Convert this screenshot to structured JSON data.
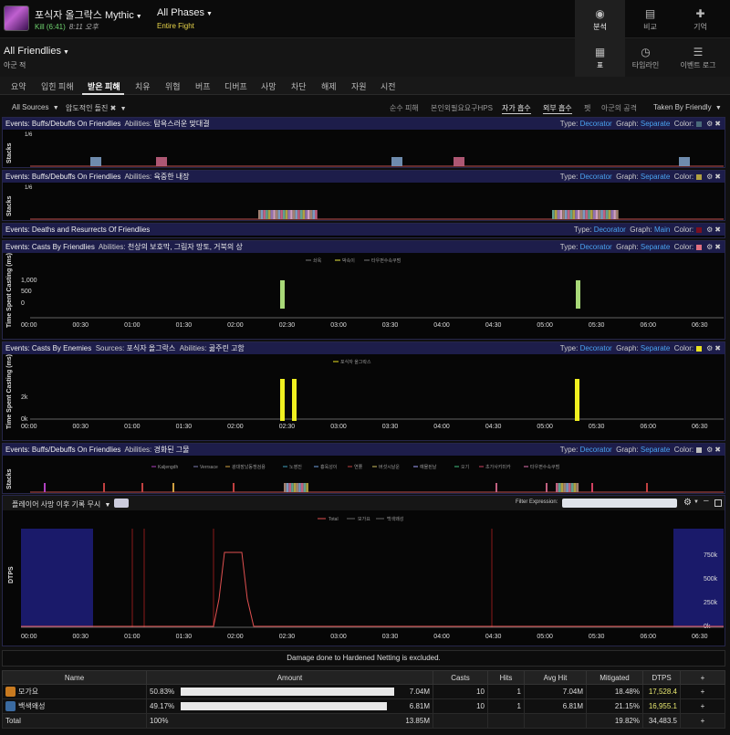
{
  "header": {
    "boss": "포식자 올그락스 Mythic",
    "kill": "Kill (6:41)",
    "time": "8:11 오후",
    "phase": "All Phases",
    "fight": "Entire Fight"
  },
  "nav": [
    {
      "label": "분석",
      "icon": "eye-icon"
    },
    {
      "label": "비교",
      "icon": "compare-icon"
    },
    {
      "label": "기억",
      "icon": "puzzle-icon"
    }
  ],
  "nav2": [
    {
      "label": "표",
      "icon": "grid-icon"
    },
    {
      "label": "타임라인",
      "icon": "clock-icon"
    },
    {
      "label": "이벤트 로그",
      "icon": "list-icon"
    }
  ],
  "scope": {
    "title": "All Friendlies",
    "sub": "아군 적"
  },
  "tabs": [
    "요약",
    "입힌 피해",
    "받은 피해",
    "치유",
    "위협",
    "버프",
    "디버프",
    "사망",
    "차단",
    "해제",
    "자원",
    "시전"
  ],
  "filters": {
    "sources": "All Sources",
    "ability": "압도적인 돌진",
    "options": [
      "순수 피해",
      "본인외필요요구HPS",
      "자가 흡수",
      "외부 흡수",
      "펫",
      "아군의 공격"
    ],
    "taken": "Taken By Friendly"
  },
  "panels": [
    {
      "head": "Events: Buffs/Debuffs On Friendlies",
      "abilLabel": "Abilities:",
      "abil": "탐욕스러운 맞대결",
      "type": "Decorator",
      "graph": "Separate",
      "color": "#4a6a7a",
      "ylabel": "Stacks",
      "stackLabel": "1/6"
    },
    {
      "head": "Events: Buffs/Debuffs On Friendlies",
      "abilLabel": "Abilities:",
      "abil": "육중한 내장",
      "type": "Decorator",
      "graph": "Separate",
      "color": "#b0a040",
      "ylabel": "Stacks",
      "stackLabel": "1/6"
    },
    {
      "head": "Events: Deaths and Resurrects Of Friendlies",
      "abilLabel": "",
      "abil": "",
      "type": "Decorator",
      "graph": "Main",
      "color": "#7a1020"
    },
    {
      "head": "Events: Casts By Friendlies",
      "abilLabel": "Abilities:",
      "abil": "천상의 보호막, 그림자 망토, 거북의 상",
      "type": "Decorator",
      "graph": "Separate",
      "color": "#e07080",
      "ylabel": "Time Spent Casting (ms)"
    },
    {
      "head": "Events: Casts By Enemies",
      "srcLabel": "Sources:",
      "src": "포식자 올그락스",
      "abilLabel": "Abilities:",
      "abil": "곪주린 고함",
      "type": "Decorator",
      "graph": "Separate",
      "color": "#e8e020",
      "ylabel": "Time Spent Casting (ms)"
    },
    {
      "head": "Events: Buffs/Debuffs On Friendlies",
      "abilLabel": "Abilities:",
      "abil": "경화된 그물",
      "type": "Decorator",
      "graph": "Separate",
      "color": "#bbbbbb",
      "ylabel": "Stacks"
    }
  ],
  "labels": {
    "type": "Type:",
    "graph": "Graph:",
    "color": "Color:"
  },
  "friendCasts": {
    "legend": [
      "솨옥",
      "박속이",
      "타우펀수속쿠범"
    ],
    "yticks": [
      "1,000",
      "500",
      "0"
    ]
  },
  "enemyCasts": {
    "legend": [
      "포식자 올그락스"
    ],
    "yticks": [
      "2k",
      "0k"
    ]
  },
  "debuffLegend": [
    "Kaljengdh",
    "Verrsace",
    "광대장났동쟁검용",
    "노영진",
    "흉욱성이",
    "연쭐",
    "버섯시날운",
    "예물된날",
    "오기",
    "초가사키미카",
    "타우편수속쿠범"
  ],
  "dtps": {
    "filter": "플레이어 사망 이후 기록 무시",
    "filterExprLabel": "Filter Expression:",
    "legend": [
      "Total",
      "모가요",
      "백색왜성"
    ],
    "ylabel": "DTPS",
    "yticks": [
      "750k",
      "500k",
      "250k",
      "0k"
    ]
  },
  "xticks": [
    "00:00",
    "00:30",
    "01:00",
    "01:30",
    "02:00",
    "02:30",
    "03:00",
    "03:30",
    "04:00",
    "04:30",
    "05:00",
    "05:30",
    "06:00",
    "06:30"
  ],
  "notice": "Damage done to Hardened Netting is excluded.",
  "table": {
    "headers": [
      "Name",
      "Amount",
      "Casts",
      "Hits",
      "Avg Hit",
      "Mitigated",
      "DTPS",
      "+"
    ],
    "rows": [
      {
        "name": "모가요",
        "pct": "50.83%",
        "frac": 0.5083,
        "amount": "7.04M",
        "casts": "10",
        "hits": "1",
        "avg": "7.04M",
        "mit": "18.48%",
        "dtps": "17,528.4",
        "plus": "+",
        "icon": "#c87a20"
      },
      {
        "name": "백색왜성",
        "pct": "49.17%",
        "frac": 0.4917,
        "amount": "6.81M",
        "casts": "10",
        "hits": "1",
        "avg": "6.81M",
        "mit": "21.15%",
        "dtps": "16,955.1",
        "plus": "+",
        "icon": "#3a6aa0"
      }
    ],
    "total": {
      "name": "Total",
      "pct": "100%",
      "amount": "13.85M",
      "mit": "19.82%",
      "dtps": "34,483.5",
      "plus": "+"
    }
  }
}
